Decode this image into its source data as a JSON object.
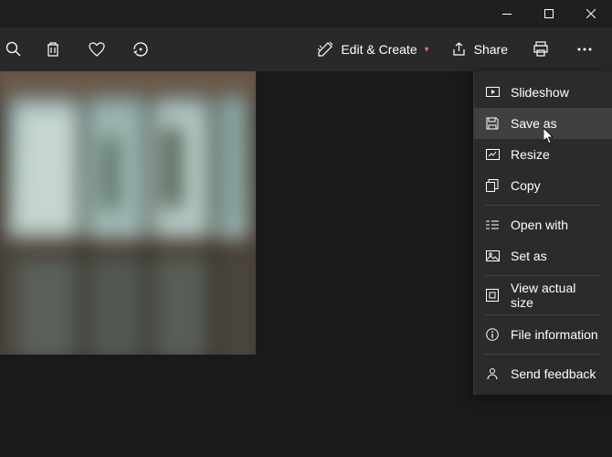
{
  "toolbar": {
    "edit_create_label": "Edit & Create",
    "share_label": "Share"
  },
  "menu": {
    "items": [
      {
        "label": "Slideshow"
      },
      {
        "label": "Save as"
      },
      {
        "label": "Resize"
      },
      {
        "label": "Copy"
      },
      {
        "label": "Open with"
      },
      {
        "label": "Set as"
      },
      {
        "label": "View actual size"
      },
      {
        "label": "File information"
      },
      {
        "label": "Send feedback"
      }
    ]
  }
}
